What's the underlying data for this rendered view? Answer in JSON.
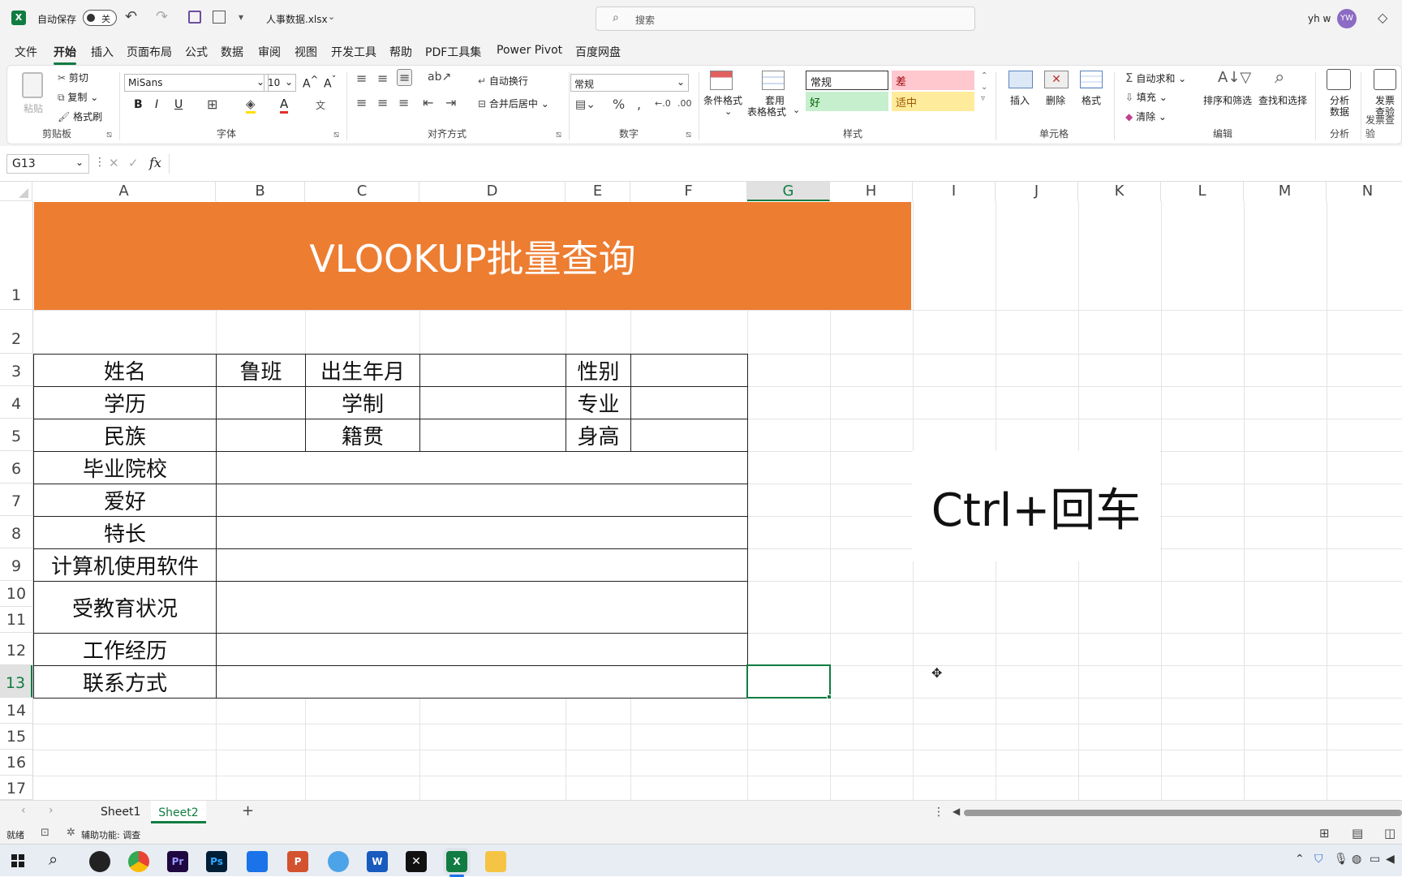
{
  "titlebar": {
    "autosave_label": "自动保存",
    "autosave_state": "关",
    "filename": "人事数据.xlsx",
    "search_placeholder": "搜索",
    "user_name": "yh w",
    "user_initials": "YW"
  },
  "menu": [
    "文件",
    "开始",
    "插入",
    "页面布局",
    "公式",
    "数据",
    "审阅",
    "视图",
    "开发工具",
    "帮助",
    "PDF工具集",
    "Power Pivot",
    "百度网盘"
  ],
  "ribbon": {
    "clipboard": {
      "paste": "粘贴",
      "cut": "剪切",
      "copy": "复制",
      "format_painter": "格式刷",
      "group": "剪贴板"
    },
    "font": {
      "name": "MiSans",
      "size": "10",
      "bold": "B",
      "italic": "I",
      "underline": "U",
      "group": "字体"
    },
    "alignment": {
      "wrap": "自动换行",
      "merge": "合并后居中",
      "group": "对齐方式"
    },
    "number": {
      "format": "常规",
      "group": "数字"
    },
    "styles": {
      "conditional": "条件格式",
      "table_format_1": "套用",
      "table_format_2": "表格格式",
      "normal": "常规",
      "bad": "差",
      "good": "好",
      "neutral": "适中",
      "group": "样式"
    },
    "cells": {
      "insert": "插入",
      "delete": "删除",
      "format": "格式",
      "group": "单元格"
    },
    "editing": {
      "autosum": "自动求和",
      "fill": "填充",
      "clear": "清除",
      "sort": "排序和筛选",
      "find": "查找和选择",
      "group": "编辑"
    },
    "analysis": {
      "analyze_1": "分析",
      "analyze_2": "数据",
      "group": "分析"
    },
    "invoice": {
      "label_1": "发票",
      "label_2": "查验",
      "group": "发票查验"
    }
  },
  "formula": {
    "namebox": "G13",
    "fx": "fx",
    "content": ""
  },
  "columns": [
    "A",
    "B",
    "C",
    "D",
    "E",
    "F",
    "G",
    "H",
    "I",
    "J",
    "K",
    "L",
    "M",
    "N"
  ],
  "rows": [
    "1",
    "2",
    "3",
    "4",
    "5",
    "6",
    "7",
    "8",
    "9",
    "10",
    "11",
    "12",
    "13",
    "14",
    "15",
    "16",
    "17"
  ],
  "sheet": {
    "banner": "VLOOKUP批量查询",
    "labels": {
      "name": "姓名",
      "name_value": "鲁班",
      "birth": "出生年月",
      "gender": "性别",
      "education": "学历",
      "duration": "学制",
      "major": "专业",
      "ethnicity": "民族",
      "origin": "籍贯",
      "height": "身高",
      "school": "毕业院校",
      "hobby": "爱好",
      "specialty": "特长",
      "software": "计算机使用软件",
      "edu_status": "受教育状况",
      "work": "工作经历",
      "contact": "联系方式"
    },
    "overlay_text": "Ctrl+回车"
  },
  "tabs": [
    "Sheet1",
    "Sheet2"
  ],
  "active_tab": "Sheet2",
  "status": {
    "ready": "就绪",
    "accessibility": "辅助功能: 调查"
  },
  "colors": {
    "banner": "#ed7d31",
    "excel_green": "#107c41",
    "bad_bg": "#ffc7ce",
    "good_bg": "#c6efce",
    "neutral_bg": "#ffeb9c"
  }
}
